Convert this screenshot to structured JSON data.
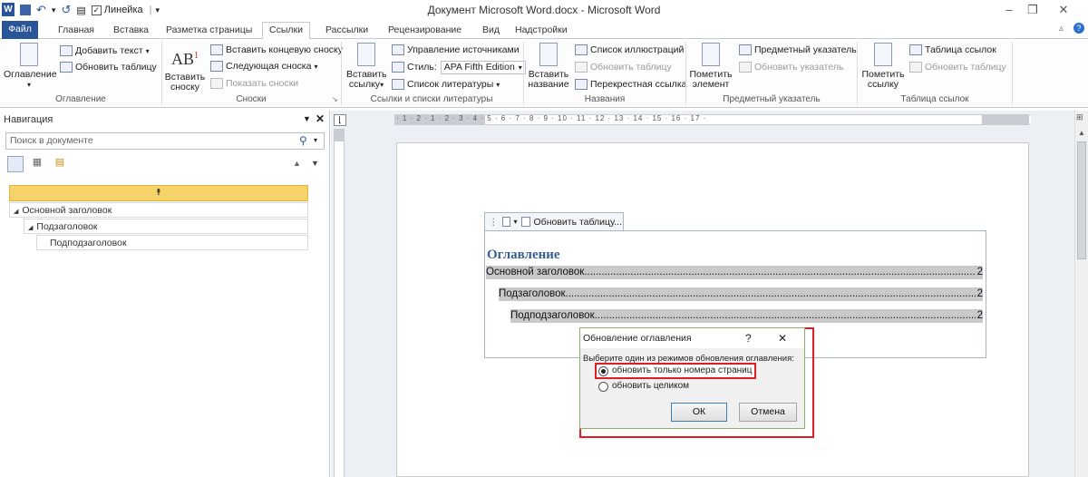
{
  "window": {
    "title": "Документ Microsoft Word.docx  -  Microsoft Word",
    "quick_access_label": "Линейка",
    "app_icon": "W"
  },
  "tabs": [
    "Файл",
    "Главная",
    "Вставка",
    "Разметка страницы",
    "Ссылки",
    "Рассылки",
    "Рецензирование",
    "Вид",
    "Надстройки"
  ],
  "active_tab": "Ссылки",
  "ribbon": {
    "toc_group": {
      "big_button": "Оглавление",
      "add_text": "Добавить текст",
      "update_table": "Обновить таблицу",
      "label": "Оглавление"
    },
    "footnotes_group": {
      "insert_footnote_line1": "Вставить",
      "insert_footnote_line2": "сноску",
      "insert_endnote": "Вставить концевую сноску",
      "next_footnote": "Следующая сноска",
      "show_notes": "Показать сноски",
      "label": "Сноски",
      "ab_glyph": "AB",
      "ab_sup": "1"
    },
    "citations_group": {
      "insert_citation_line1": "Вставить",
      "insert_citation_line2": "ссылку",
      "manage_sources": "Управление источниками",
      "style_label": "Стиль:",
      "style_value": "APA Fifth Edition",
      "bibliography": "Список литературы",
      "label": "Ссылки и списки литературы"
    },
    "captions_group": {
      "insert_caption_line1": "Вставить",
      "insert_caption_line2": "название",
      "insert_figures": "Список иллюстраций",
      "update_table": "Обновить таблицу",
      "cross_reference": "Перекрестная ссылка",
      "label": "Названия"
    },
    "index_group": {
      "mark_entry_line1": "Пометить",
      "mark_entry_line2": "элемент",
      "insert_index": "Предметный указатель",
      "update_index": "Обновить указатель",
      "label": "Предметный указатель"
    },
    "toa_group": {
      "mark_citation_line1": "Пометить",
      "mark_citation_line2": "ссылку",
      "insert_toa": "Таблица ссылок",
      "update_table": "Обновить таблицу",
      "label": "Таблица ссылок"
    }
  },
  "navigation": {
    "title": "Навигация",
    "search_placeholder": "Поиск в документе",
    "items": [
      {
        "label": "Основной заголовок"
      },
      {
        "label": "Подзаголовок"
      },
      {
        "label": "Подподзаголовок"
      }
    ]
  },
  "document": {
    "toc_tool_label": "Обновить таблицу...",
    "toc_title": "Оглавление",
    "toc_entries": [
      {
        "text": "Основной заголовок",
        "page": "2"
      },
      {
        "text": "Подзаголовок",
        "page": "2"
      },
      {
        "text": "Подподзаголовок",
        "page": "2"
      }
    ],
    "ruler_text": "· 1 · 2 · 1 · 2 · 3 · 4 · 5 · 6 · 7 · 8 · 9 · 10 · 11 · 12 · 13 · 14 · 15 · 16 · 17 ·"
  },
  "dialog": {
    "title": "Обновление оглавления",
    "help": "?",
    "close": "✕",
    "prompt": "Выберите один из режимов обновления оглавления:",
    "option_pages": "обновить только номера страниц",
    "option_all": "обновить целиком",
    "ok": "ОК",
    "cancel": "Отмена"
  },
  "colors": {
    "file_tab": "#2a5699",
    "highlight": "#e21b25",
    "nav_selected": "#f5d36a"
  }
}
